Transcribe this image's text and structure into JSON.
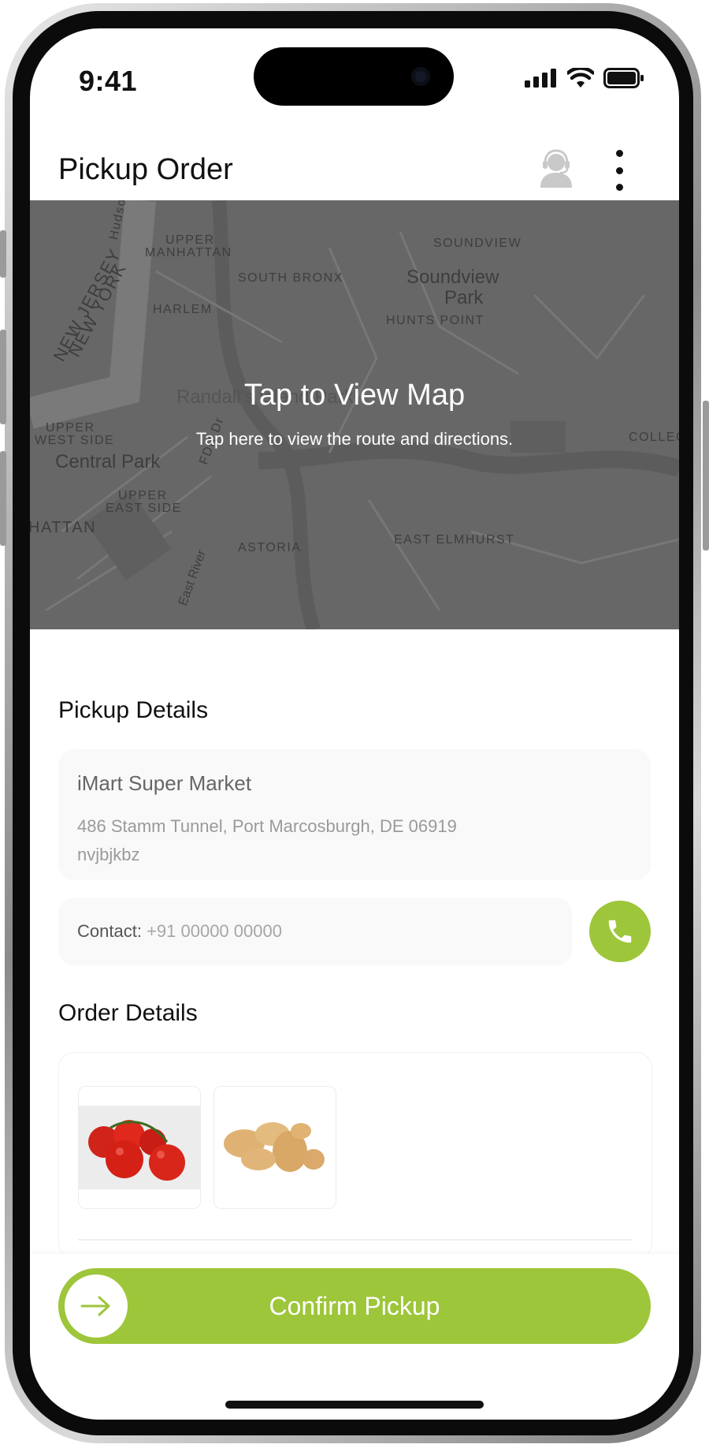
{
  "status_bar": {
    "time": "9:41",
    "icons": [
      "signal-icon",
      "wifi-icon",
      "battery-icon"
    ]
  },
  "header": {
    "title": "Pickup Order",
    "support_icon": "support-agent-icon",
    "menu_icon": "more-vertical-icon"
  },
  "map": {
    "title": "Tap to View Map",
    "subtitle": "Tap here to view the route and directions.",
    "labels": {
      "hudson": "Hudson",
      "upper_manhattan_1": "UPPER",
      "upper_manhattan_2": "MANHATTAN",
      "new_jersey": "NEW JERSEY",
      "new_york": "NEW YORK",
      "south_bronx": "SOUTH BRONX",
      "soundview": "SOUNDVIEW",
      "soundview_park_1": "Soundview",
      "soundview_park_2": "Park",
      "harlem": "HARLEM",
      "hunts_point": "HUNTS POINT",
      "randalls_island": "Randall's Island Park",
      "upper_west_side_1": "UPPER",
      "upper_west_side_2": "WEST SIDE",
      "fdr": "FDR Dr",
      "central_park": "Central Park",
      "upper_east_side_1": "UPPER",
      "upper_east_side_2": "EAST SIDE",
      "manhattan": "HATTAN",
      "astoria": "ASTORIA",
      "east_river": "East River",
      "east_elmhurst": "EAST ELMHURST",
      "college": "COLLEG"
    }
  },
  "pickup_details": {
    "section_title": "Pickup Details",
    "store_name": "iMart Super Market",
    "address_line1": "486 Stamm Tunnel, Port Marcosburgh, DE 06919",
    "address_line2": "nvjbjkbz",
    "contact_label": "Contact:",
    "contact_value": "+91 00000 00000",
    "call_icon": "phone-icon"
  },
  "order_details": {
    "section_title": "Order Details",
    "items": [
      {
        "name": "tomatoes-image"
      },
      {
        "name": "potatoes-image"
      }
    ]
  },
  "footer": {
    "confirm_label": "Confirm Pickup",
    "confirm_icon": "arrow-right-icon"
  },
  "colors": {
    "accent": "#9dc63a",
    "map_overlay": "#676767",
    "text": "#111111"
  }
}
